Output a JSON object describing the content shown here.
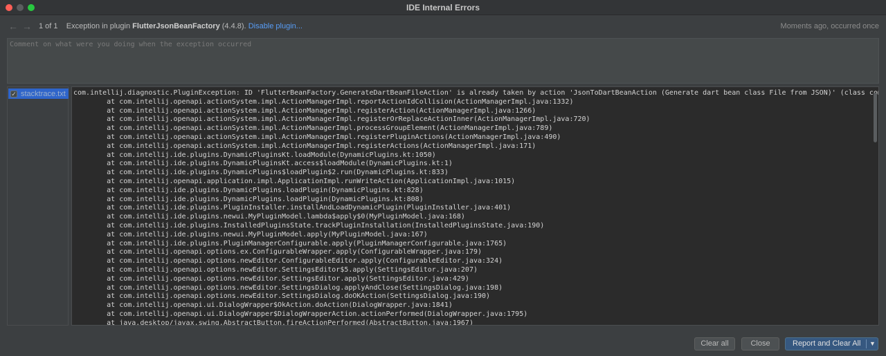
{
  "window": {
    "title": "IDE Internal Errors"
  },
  "header": {
    "counter": "1 of 1",
    "message_prefix": "Exception in plugin",
    "plugin_name": "FlutterJsonBeanFactory",
    "plugin_version": "(4.4.8).",
    "disable_link": "Disable plugin...",
    "occurrence": "Moments ago, occurred once"
  },
  "comment": {
    "placeholder": "Comment on what were you doing when the exception occurred"
  },
  "attachments": {
    "items": [
      {
        "label": "stacktrace.txt",
        "checked": true
      }
    ]
  },
  "trace": {
    "lines": [
      "com.intellij.diagnostic.PluginException: ID 'FlutterBeanFactory.GenerateDartBeanFileAction' is already taken by action 'JsonToDartBeanAction (Generate dart bean class File from JSON)' (class com.intellij.openapi.actionSystem.impl.ActionManagerImpl",
      "        at com.intellij.openapi.actionSystem.impl.ActionManagerImpl.reportActionIdCollision(ActionManagerImpl.java:1332)",
      "        at com.intellij.openapi.actionSystem.impl.ActionManagerImpl.registerAction(ActionManagerImpl.java:1266)",
      "        at com.intellij.openapi.actionSystem.impl.ActionManagerImpl.registerOrReplaceActionInner(ActionManagerImpl.java:720)",
      "        at com.intellij.openapi.actionSystem.impl.ActionManagerImpl.processGroupElement(ActionManagerImpl.java:789)",
      "        at com.intellij.openapi.actionSystem.impl.ActionManagerImpl.registerPluginActions(ActionManagerImpl.java:490)",
      "        at com.intellij.openapi.actionSystem.impl.ActionManagerImpl.registerActions(ActionManagerImpl.java:171)",
      "        at com.intellij.ide.plugins.DynamicPluginsKt.loadModule(DynamicPlugins.kt:1050)",
      "        at com.intellij.ide.plugins.DynamicPluginsKt.access$loadModule(DynamicPlugins.kt:1)",
      "        at com.intellij.ide.plugins.DynamicPlugins$loadPlugin$2.run(DynamicPlugins.kt:833)",
      "        at com.intellij.openapi.application.impl.ApplicationImpl.runWriteAction(ApplicationImpl.java:1015)",
      "        at com.intellij.ide.plugins.DynamicPlugins.loadPlugin(DynamicPlugins.kt:828)",
      "        at com.intellij.ide.plugins.DynamicPlugins.loadPlugin(DynamicPlugins.kt:808)",
      "        at com.intellij.ide.plugins.PluginInstaller.installAndLoadDynamicPlugin(PluginInstaller.java:401)",
      "        at com.intellij.ide.plugins.newui.MyPluginModel.lambda$apply$0(MyPluginModel.java:168)",
      "        at com.intellij.ide.plugins.InstalledPluginsState.trackPluginInstallation(InstalledPluginsState.java:190)",
      "        at com.intellij.ide.plugins.newui.MyPluginModel.apply(MyPluginModel.java:167)",
      "        at com.intellij.ide.plugins.PluginManagerConfigurable.apply(PluginManagerConfigurable.java:1765)",
      "        at com.intellij.openapi.options.ex.ConfigurableWrapper.apply(ConfigurableWrapper.java:179)",
      "        at com.intellij.openapi.options.newEditor.ConfigurableEditor.apply(ConfigurableEditor.java:324)",
      "        at com.intellij.openapi.options.newEditor.SettingsEditor$5.apply(SettingsEditor.java:207)",
      "        at com.intellij.openapi.options.newEditor.SettingsEditor.apply(SettingsEditor.java:429)",
      "        at com.intellij.openapi.options.newEditor.SettingsDialog.applyAndClose(SettingsDialog.java:198)",
      "        at com.intellij.openapi.options.newEditor.SettingsDialog.doOKAction(SettingsDialog.java:190)",
      "        at com.intellij.openapi.ui.DialogWrapper$OkAction.doAction(DialogWrapper.java:1841)",
      "        at com.intellij.openapi.ui.DialogWrapper$DialogWrapperAction.actionPerformed(DialogWrapper.java:1795)",
      "        at java.desktop/javax.swing.AbstractButton.fireActionPerformed(AbstractButton.java:1967)"
    ]
  },
  "footer": {
    "clear_all": "Clear all",
    "close": "Close",
    "report": "Report and Clear All"
  },
  "colors": {
    "accent": "#365880",
    "link": "#589df6",
    "selection": "#2f65ca"
  }
}
